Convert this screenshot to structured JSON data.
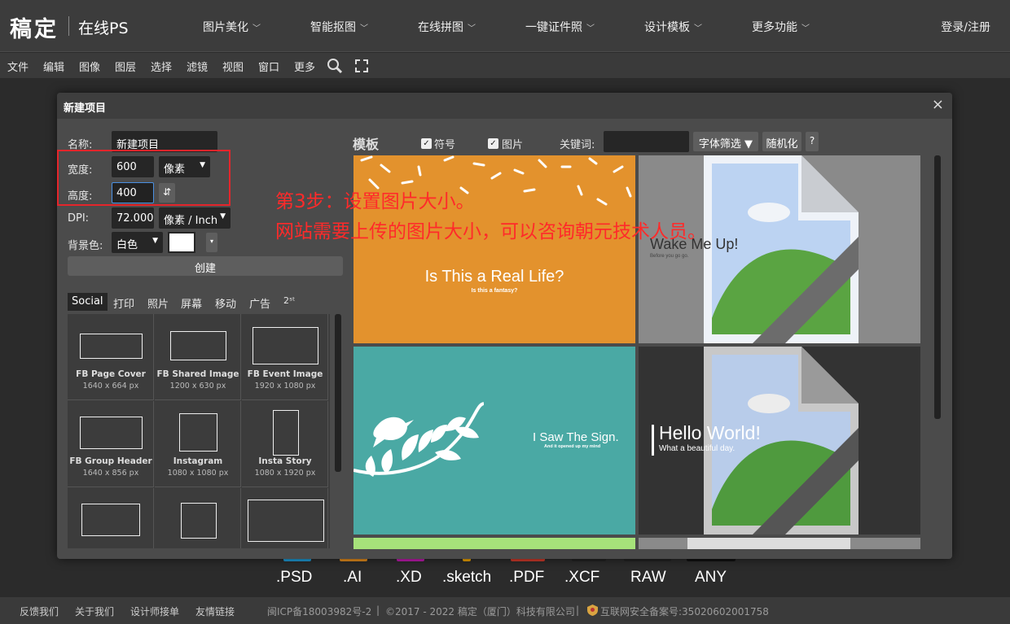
{
  "brand": {
    "logo": "稿定",
    "subtitle": "在线PS"
  },
  "nav": {
    "items": [
      "图片美化",
      "智能抠图",
      "在线拼图",
      "一键证件照",
      "设计模板",
      "更多功能"
    ],
    "login": "登录/注册"
  },
  "menu": {
    "items": [
      "文件",
      "编辑",
      "图像",
      "图层",
      "选择",
      "滤镜",
      "视图",
      "窗口",
      "更多"
    ]
  },
  "formats": [
    ".PSD",
    ".AI",
    ".XD",
    ".sketch",
    ".PDF",
    ".XCF",
    "RAW",
    "ANY"
  ],
  "footer": {
    "links": [
      "反馈我们",
      "关于我们",
      "设计师接单",
      "友情链接"
    ],
    "icp": "闽ICP备18003982号-2",
    "copyright": "©2017 - 2022 稿定（厦门）科技有限公司",
    "security": "互联网安全备案号:35020602001758"
  },
  "dialog": {
    "title": "新建项目",
    "close": "×",
    "name_label": "名称:",
    "name_value": "新建项目",
    "width_label": "宽度:",
    "width_value": "600",
    "width_unit": "像素",
    "height_label": "高度:",
    "height_value": "400",
    "swap_icon": "⇵",
    "dpi_label": "DPI:",
    "dpi_value": "72.000",
    "dpi_unit": "像素 / Inch",
    "bg_label": "背景色:",
    "bg_value": "白色",
    "bg_swatch": "#ffffff",
    "create": "创建",
    "tabs": [
      "Social",
      "打印",
      "照片",
      "屏幕",
      "移动",
      "广告",
      "2ˢᵗ"
    ],
    "presets": [
      {
        "name": "FB Page Cover",
        "size": "1640 x 664 px"
      },
      {
        "name": "FB Shared Image",
        "size": "1200 x 630 px"
      },
      {
        "name": "FB Event Image",
        "size": "1920 x 1080 px"
      },
      {
        "name": "FB Group Header",
        "size": "1640 x 856 px"
      },
      {
        "name": "Instagram",
        "size": "1080 x 1080 px"
      },
      {
        "name": "Insta Story",
        "size": "1080 x 1920 px"
      },
      {
        "name": "",
        "size": ""
      },
      {
        "name": "",
        "size": ""
      },
      {
        "name": "",
        "size": ""
      }
    ],
    "templates_label": "模板",
    "chk_symbol": "符号",
    "chk_image": "图片",
    "keyword_label": "关键词:",
    "font_filter": "字体筛选 ▼",
    "random": "随机化",
    "help": "?"
  },
  "annotation": {
    "line1": "第3步：设置图片大小。",
    "line2": "网站需要上传的图片大小，可以咨询朝元技术人员。"
  },
  "templates": {
    "t1_title": "Is This a Real Life?",
    "t1_sub": "Is this a fantasy?",
    "t2_title": "Wake Me Up!",
    "t2_sub": "Before you go go.",
    "t3_title": "I Saw The Sign.",
    "t3_sub": "And it opened up my mind",
    "t4_title": "Hello World!",
    "t4_sub": "What a beautiful day."
  },
  "colors": {
    "accent_red": "#e5252b",
    "orange": "#e3922d",
    "teal": "#4aa9a4",
    "focus_blue": "#4a90e2"
  }
}
